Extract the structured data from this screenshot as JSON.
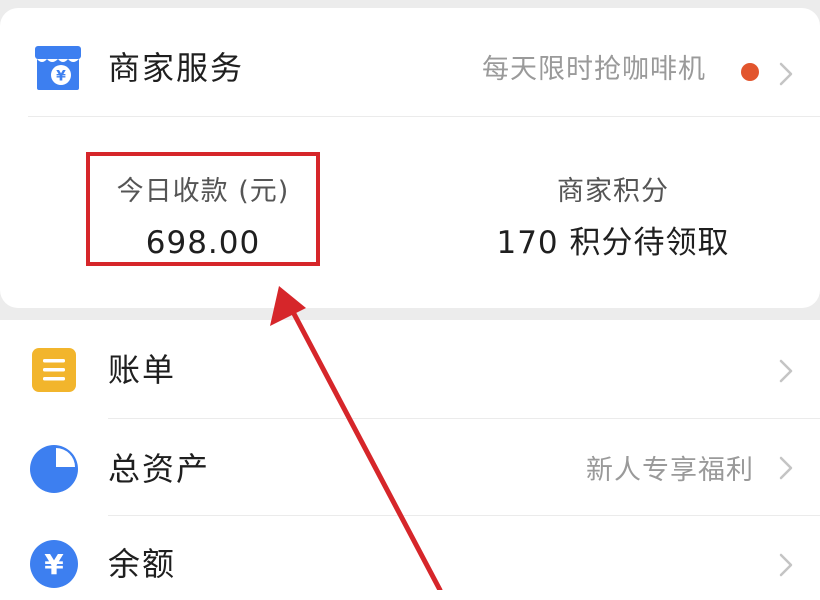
{
  "merchant_service": {
    "title": "商家服务",
    "promo": "每天限时抢咖啡机",
    "icon": "storefront-icon",
    "promo_dot_color": "#e2552d"
  },
  "stats": {
    "today_income_label": "今日收款 (元)",
    "today_income_value": "698.00",
    "points_label": "商家积分",
    "points_value": "170 积分待领取"
  },
  "menu": {
    "items": [
      {
        "label": "账单",
        "hint": "",
        "icon": "bill-list-icon",
        "color": "#f2b52c"
      },
      {
        "label": "总资产",
        "hint": "新人专享福利",
        "icon": "pie-chart-icon",
        "color": "#3d7ff0"
      },
      {
        "label": "余额",
        "hint": "",
        "icon": "yuan-coin-icon",
        "color": "#3d7ff0"
      }
    ]
  },
  "annotation": {
    "color": "#d6262a"
  }
}
